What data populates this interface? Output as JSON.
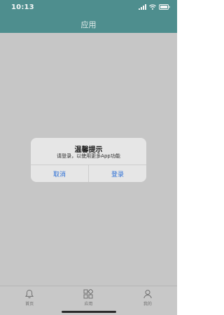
{
  "status_bar": {
    "time": "10:13"
  },
  "header": {
    "title": "应用",
    "background": "#4e8e8e"
  },
  "dialog": {
    "title": "温馨提示",
    "message": "请登录，以使用更多App功能",
    "cancel_label": "取消",
    "confirm_label": "登录",
    "button_color": "#2f71d6"
  },
  "tabbar": {
    "items": [
      {
        "label": "首页",
        "icon": "bell-icon"
      },
      {
        "label": "应用",
        "icon": "apps-grid-icon"
      },
      {
        "label": "我的",
        "icon": "user-icon"
      }
    ]
  }
}
